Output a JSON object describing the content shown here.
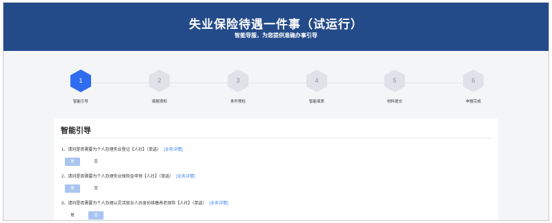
{
  "header": {
    "title": "失业保险待遇一件事（试运行）",
    "subtitle": "智能导服，为您提供准确办事引导"
  },
  "steps": [
    {
      "number": "1",
      "label": "智能引导",
      "active": true
    },
    {
      "number": "2",
      "label": "填报须知",
      "active": false
    },
    {
      "number": "3",
      "label": "条件预检",
      "active": false
    },
    {
      "number": "4",
      "label": "智能填表",
      "active": false
    },
    {
      "number": "5",
      "label": "材料提交",
      "active": false
    },
    {
      "number": "6",
      "label": "申报完成",
      "active": false
    }
  ],
  "guide": {
    "title": "智能引导",
    "questions": [
      {
        "text": "1、请问是否需要为个人办理失业登记【人社】（单选）",
        "link": "[业务详情]",
        "options": [
          "是",
          "否"
        ],
        "selected": "是"
      },
      {
        "text": "2、请问是否需要为个人办理失业保险金申领【人社】（单选）",
        "link": "[业务详情]",
        "options": [
          "是",
          "否"
        ],
        "selected": "是"
      },
      {
        "text": "3、请问是否需要为个人办理以灵活就业人员身份续缴养老保险【人社】（单选）",
        "link": "[业务详情]",
        "options": [
          "是",
          "否"
        ],
        "selected": "否"
      }
    ]
  },
  "colors": {
    "banner": "#244b89",
    "step_active": "#2f6cf0",
    "step_inactive": "#dfe2e8",
    "option_selected": "#a9c4f0",
    "link": "#3b82f6"
  }
}
